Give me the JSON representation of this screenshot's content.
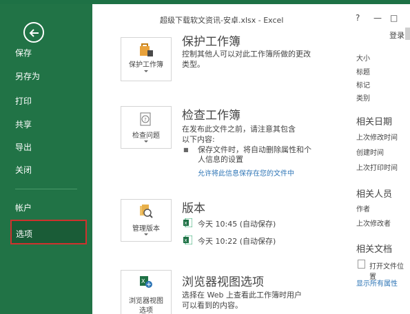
{
  "window": {
    "title": "超级下载软文资讯-安卓.xlsx - Excel",
    "help": "?",
    "minimize": "—",
    "restore": "□",
    "login": "登录"
  },
  "colors": {
    "nav_bg": "#217346",
    "nav_selected_border": "#d0312d",
    "accent_green": "#1e7145",
    "link": "#2e75b6"
  },
  "nav": {
    "back_icon": "back-arrow-icon",
    "items": [
      {
        "label": "保存"
      },
      {
        "label": "另存为"
      },
      {
        "label": "打印"
      },
      {
        "label": "共享"
      },
      {
        "label": "导出"
      },
      {
        "label": "关闭"
      },
      {
        "label": "帐户"
      },
      {
        "label": "选项",
        "selected": true
      }
    ]
  },
  "sections": {
    "protect": {
      "button_label": "保护工作簿",
      "title": "保护工作簿",
      "desc1": "控制其他人可以对此工作簿所做的更改",
      "desc2": "类型。"
    },
    "inspect": {
      "button_label": "检查问题",
      "title": "检查工作簿",
      "desc1": "在发布此文件之前，请注意其包含",
      "desc2": "以下内容:",
      "bullet1": "保存文件时，将自动删除属性和个",
      "bullet2": "人信息的设置",
      "link": "允许将此信息保存在您的文件中"
    },
    "versions": {
      "button_label": "管理版本",
      "title": "版本",
      "items": [
        {
          "label": "今天 10:45 (自动保存)"
        },
        {
          "label": "今天 10:22 (自动保存)"
        }
      ]
    },
    "browser": {
      "button_label_1": "浏览器视图",
      "button_label_2": "选项",
      "title": "浏览器视图选项",
      "desc1": "选择在 Web 上查看此工作簿时用户",
      "desc2": "可以看到的内容。"
    }
  },
  "properties": {
    "items": [
      "大小",
      "标题",
      "标记",
      "类别"
    ],
    "dates_heading": "相关日期",
    "dates": [
      "上次修改时间",
      "创建时间",
      "上次打印时间"
    ],
    "people_heading": "相关人员",
    "people": [
      "作者",
      "上次修改者"
    ],
    "docs_heading": "相关文档",
    "open_location": "打开文件位置",
    "show_all": "显示所有属性"
  }
}
